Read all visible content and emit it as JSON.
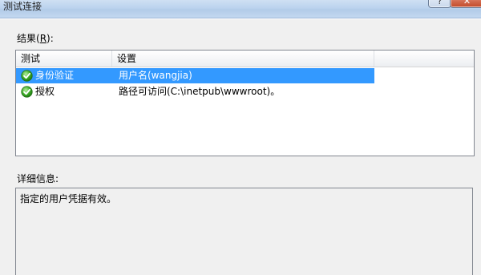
{
  "window": {
    "title": "测试连接",
    "help_label": "?",
    "close_label": "✕"
  },
  "results": {
    "label_prefix": "结果(",
    "label_accel": "R",
    "label_suffix": "):",
    "columns": [
      "测试",
      "设置"
    ],
    "rows": [
      {
        "test": "身份验证",
        "setting": "用户名(wangjia)",
        "status_icon": "check-green-icon",
        "selected": true
      },
      {
        "test": "授权",
        "setting": "路径可访问(C:\\inetpub\\wwwroot)。",
        "status_icon": "check-green-icon",
        "selected": false
      }
    ]
  },
  "details": {
    "label": "详细信息:",
    "text": "指定的用户凭据有效。"
  },
  "colors": {
    "selection": "#3399ff",
    "check": "#3fae29"
  }
}
